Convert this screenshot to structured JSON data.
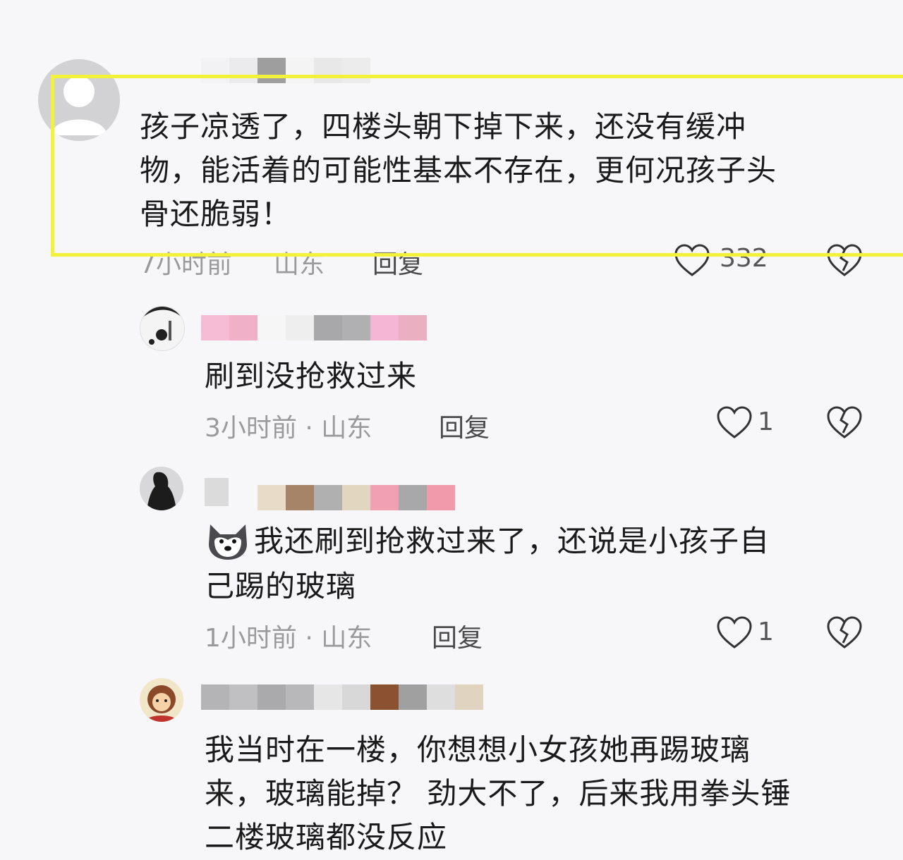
{
  "comments": [
    {
      "text_lines": [
        "孩子凉透了，四楼头朝下掉下来，还没有缓冲",
        "物，能活着的可能性基本不存在，更何况孩子头",
        "骨还脆弱！"
      ],
      "time": "7小时前",
      "location": "山东",
      "reply_label": "回复",
      "like_count": "332",
      "username_mosaic": [
        "#f2f2f4",
        "#ebebed",
        "#9e9e9e",
        "#f4f4f4",
        "#e8e8e8",
        "#ececec"
      ]
    },
    {
      "text_lines": [
        "刷到没抢救过来"
      ],
      "meta": "3小时前 · 山东",
      "reply_label": "回复",
      "like_count": "1",
      "username_mosaic": [
        "#f6bcd6",
        "#f0b0c8",
        "#f6f6f6",
        "#eeeeee",
        "#a8a8aa",
        "#b0b0b2",
        "#f4b6d4",
        "#eab0c2"
      ]
    },
    {
      "text_lines": [
        "我还刷到抢救过来了，还说是小孩子自",
        "己踢的玻璃"
      ],
      "meta": "1小时前 · 山东",
      "reply_label": "回复",
      "like_count": "1",
      "emoji_icon": "husky-emoji-icon",
      "username_mosaic": [
        "#e8dcc8",
        "#a68468",
        "#b0b0b0",
        "#e2d6c0",
        "#f0a0b0",
        "#a8a8aa",
        "#f09aac"
      ]
    },
    {
      "text_lines": [
        "我当时在一楼，你想想小女孩她再踢玻璃",
        "来，玻璃能掉？ 劲大不了，后来我用拳头锤",
        "二楼玻璃都没反应"
      ],
      "username_mosaic": [
        "#b4b4b6",
        "#c0c0c2",
        "#aaaaac",
        "#b8b8ba",
        "#e6e6e6",
        "#d8d8d8",
        "#8a5230",
        "#a0a0a0",
        "#dedede",
        "#e0d4c0"
      ]
    }
  ],
  "colors": {
    "highlight_border": "#f2f23a",
    "background": "#f7f7f9"
  }
}
